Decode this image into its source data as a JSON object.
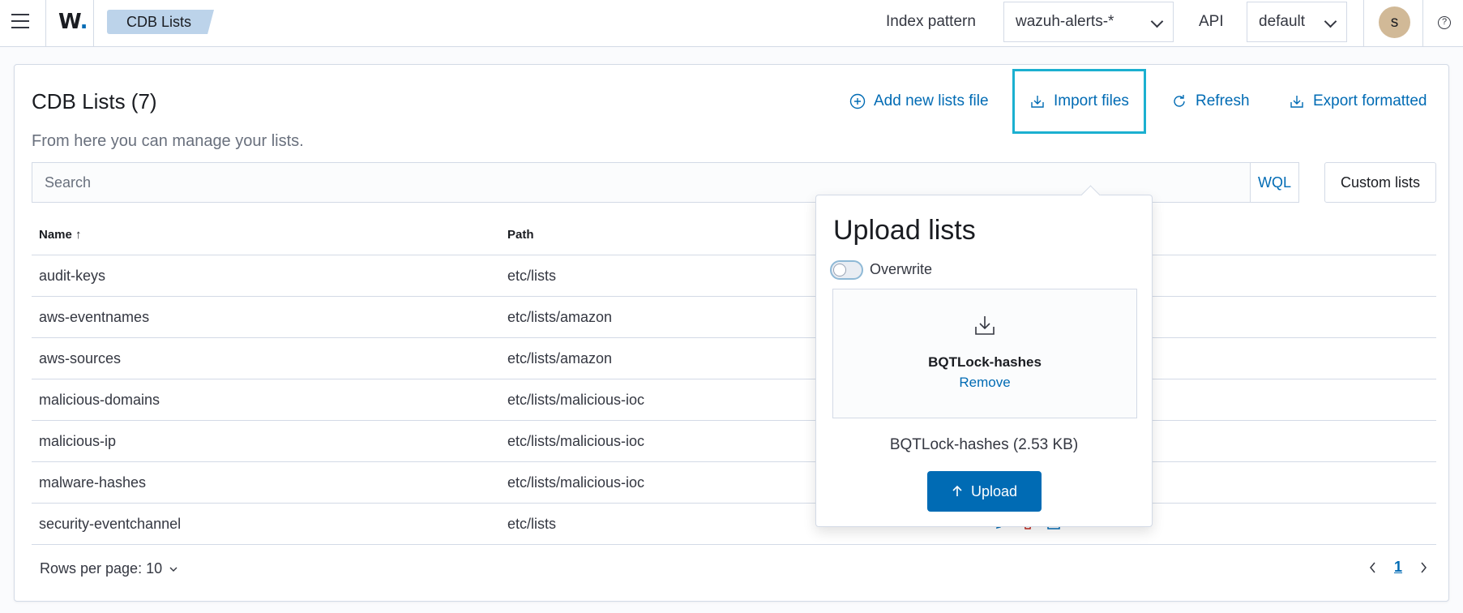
{
  "topbar": {
    "logo_text": "W",
    "breadcrumb": "CDB Lists",
    "index_pattern_label": "Index pattern",
    "index_pattern_value": "wazuh-alerts-*",
    "api_label": "API",
    "api_value": "default",
    "avatar_initial": "s",
    "help_symbol": "?"
  },
  "page": {
    "title": "CDB Lists (7)",
    "subtitle": "From here you can manage your lists.",
    "actions": {
      "add": "Add new lists file",
      "import": "Import files",
      "refresh": "Refresh",
      "export": "Export formatted"
    },
    "search_placeholder": "Search",
    "wql_label": "WQL",
    "custom_lists_label": "Custom lists"
  },
  "table": {
    "columns": [
      "Name",
      "Path"
    ],
    "rows": [
      {
        "name": "audit-keys",
        "path": "etc/lists"
      },
      {
        "name": "aws-eventnames",
        "path": "etc/lists/amazon"
      },
      {
        "name": "aws-sources",
        "path": "etc/lists/amazon"
      },
      {
        "name": "malicious-domains",
        "path": "etc/lists/malicious-ioc"
      },
      {
        "name": "malicious-ip",
        "path": "etc/lists/malicious-ioc"
      },
      {
        "name": "malware-hashes",
        "path": "etc/lists/malicious-ioc"
      },
      {
        "name": "security-eventchannel",
        "path": "etc/lists"
      }
    ]
  },
  "pagination": {
    "rows_per_page": "Rows per page: 10",
    "current_page": "1"
  },
  "popover": {
    "title": "Upload lists",
    "overwrite_label": "Overwrite",
    "overwrite_on": false,
    "file_name": "BQTLock-hashes",
    "remove_label": "Remove",
    "file_info": "BQTLock-hashes (2.53 KB)",
    "upload_label": "Upload"
  },
  "colors": {
    "accent": "#006bb4",
    "danger": "#bd271e",
    "focus": "#1bb0d0"
  }
}
